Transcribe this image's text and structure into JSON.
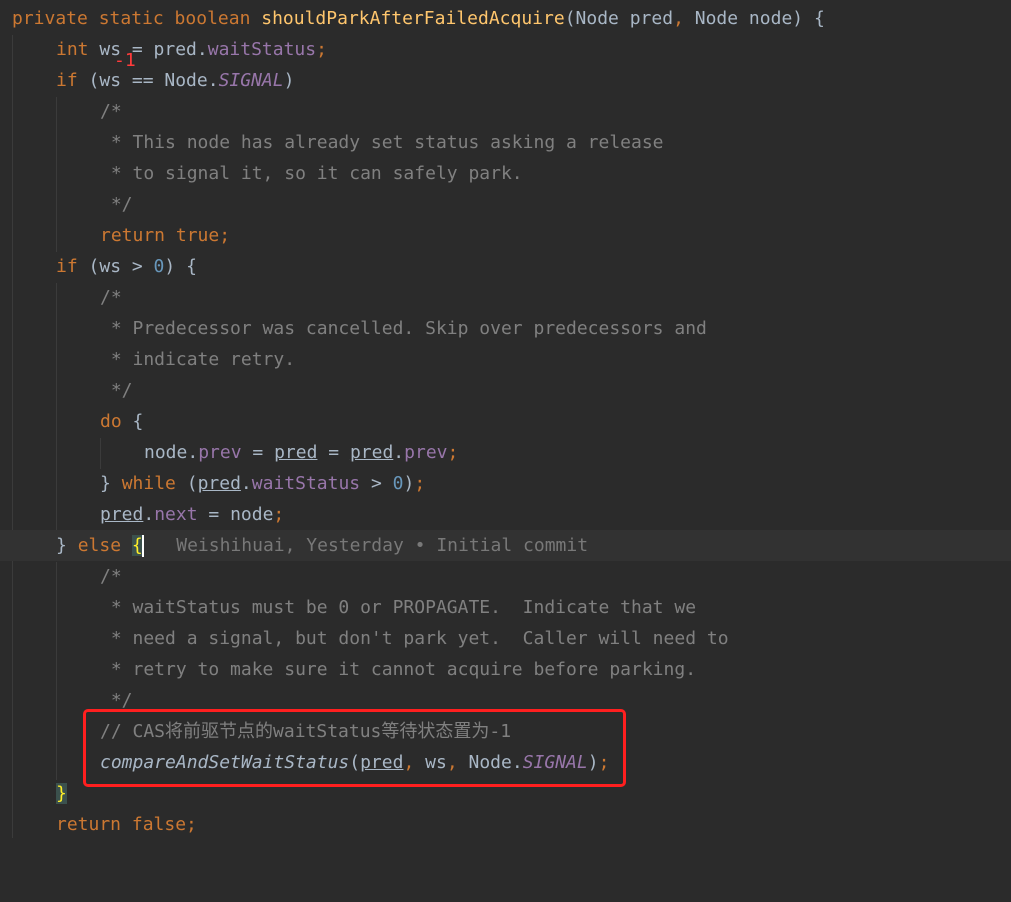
{
  "editor": {
    "lines": {
      "l1": {
        "mod": "private static boolean ",
        "fn": "shouldParkAfterFailedAcquire",
        "params_a": "(Node pred",
        "comma": ",",
        "params_b": " Node node) {"
      },
      "l2": {
        "type": "int",
        "rest": " ws = pred.",
        "field": "waitStatus",
        "semi": ";"
      },
      "l3": {
        "kw": "if",
        "rest": " (ws == Node.",
        "sfield": "SIGNAL",
        "close": ")"
      },
      "l4": "/*",
      "l5": " * This node has already set status asking a release",
      "l6": " * to signal it, so it can safely park.",
      "l7": " */",
      "l8": {
        "kw": "return true",
        "semi": ";"
      },
      "l9": {
        "kw": "if",
        "a": " (ws > ",
        "num": "0",
        "b": ") {"
      },
      "l10": "/*",
      "l11": " * Predecessor was cancelled. Skip over predecessors and",
      "l12": " * indicate retry.",
      "l13": " */",
      "l14": {
        "kw": "do",
        "rest": " {"
      },
      "l15": {
        "a": "node.",
        "f1": "prev",
        "b": " = ",
        "p1": "pred",
        "c": " = ",
        "p2": "pred",
        "d": ".",
        "f2": "prev",
        "semi": ";"
      },
      "l16": {
        "a": "} ",
        "kw": "while",
        "b": " (",
        "p": "pred",
        "c": ".",
        "f": "waitStatus",
        "d": " > ",
        "num": "0",
        "e": ")",
        "semi": ";"
      },
      "l17": {
        "p": "pred",
        "a": ".",
        "f": "next",
        "b": " = node",
        "semi": ";"
      },
      "l18": {
        "a": "} ",
        "kw": "else",
        "sp": " ",
        "brace": "{",
        "blame": "   Weishihuai, Yesterday • Initial commit"
      },
      "l19": "/*",
      "l20": " * waitStatus must be 0 or PROPAGATE.  Indicate that we",
      "l21": " * need a signal, but don't park yet.  Caller will need to",
      "l22": " * retry to make sure it cannot acquire before parking.",
      "l23": " */",
      "l24": "// CAS将前驱节点的waitStatus等待状态置为-1",
      "l25": {
        "fn": "compareAndSetWaitStatus",
        "a": "(",
        "p": "pred",
        "c1": ",",
        "b": " ws",
        "c2": ",",
        "c": " Node.",
        "sf": "SIGNAL",
        "d": ")",
        "semi": ";"
      },
      "l26": "}",
      "l27": {
        "kw": "return false",
        "semi": ";"
      }
    },
    "annotation_value": "-1"
  },
  "colors": {
    "background": "#2b2b2b",
    "keyword": "#cc7832",
    "function": "#ffc66d",
    "field": "#9876aa",
    "number": "#6897bb",
    "comment": "#808080",
    "text": "#a9b7c6",
    "highlight_box": "#ff1f1f"
  }
}
